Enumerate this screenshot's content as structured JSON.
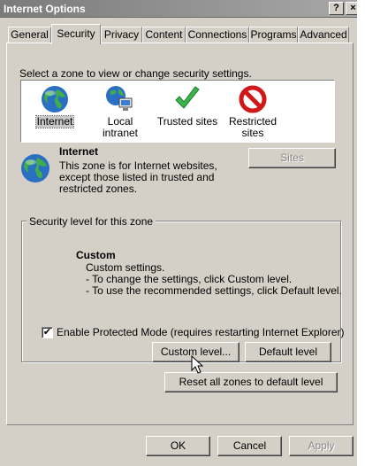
{
  "window": {
    "title": "Internet Options",
    "help_label": "?",
    "close_label": "×"
  },
  "tabs": [
    {
      "label": "General"
    },
    {
      "label": "Security",
      "active": true
    },
    {
      "label": "Privacy"
    },
    {
      "label": "Content"
    },
    {
      "label": "Connections"
    },
    {
      "label": "Programs"
    },
    {
      "label": "Advanced"
    }
  ],
  "zones": {
    "instruction": "Select a zone to view or change security settings.",
    "items": [
      {
        "label": "Internet",
        "icon": "globe-icon",
        "selected": true
      },
      {
        "label": "Local intranet",
        "icon": "intranet-icon"
      },
      {
        "label": "Trusted sites",
        "icon": "checkmark-icon"
      },
      {
        "label": "Restricted sites",
        "icon": "restricted-icon"
      }
    ]
  },
  "zone_info": {
    "title": "Internet",
    "description": "This zone is for Internet websites, except those listed in trusted and restricted zones.",
    "sites_button": "Sites"
  },
  "security_level": {
    "group_title": "Security level for this zone",
    "level_name": "Custom",
    "lines": [
      "Custom settings.",
      "- To change the settings, click Custom level.",
      "- To use the recommended settings, click Default level."
    ],
    "protected_mode_label": "Enable Protected Mode (requires restarting Internet Explorer)",
    "protected_mode_checked": true,
    "custom_level_button": "Custom level...",
    "default_level_button": "Default level"
  },
  "reset_button": "Reset all zones to default level",
  "footer": {
    "ok": "OK",
    "cancel": "Cancel",
    "apply": "Apply"
  },
  "colors": {
    "titlebar": "#8a8a8a",
    "face": "#d4d0c8",
    "check": "#39b54a",
    "restricted": "#d01818"
  }
}
